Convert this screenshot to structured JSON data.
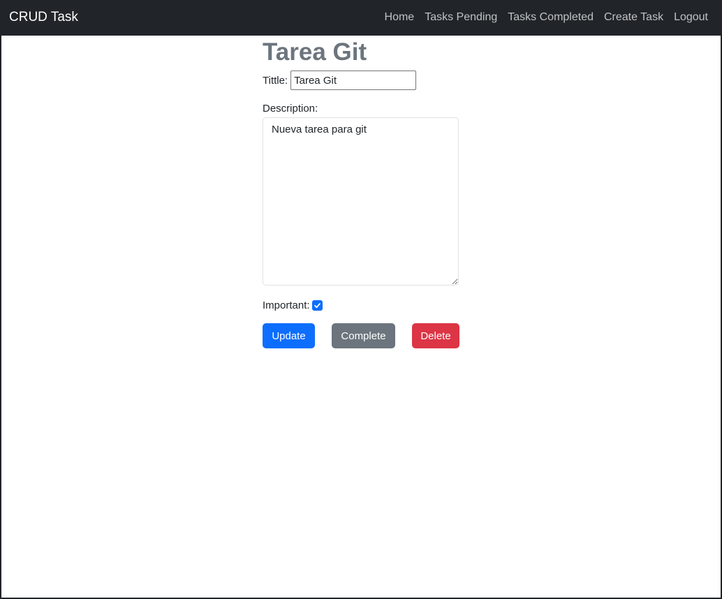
{
  "navbar": {
    "brand": "CRUD Task",
    "links": [
      "Home",
      "Tasks Pending",
      "Tasks Completed",
      "Create Task",
      "Logout"
    ]
  },
  "task": {
    "heading": "Tarea Git",
    "title_label": "Tittle:",
    "title_value": "Tarea Git",
    "description_label": "Description:",
    "description_value": "Nueva tarea para git",
    "important_label": "Important:",
    "important_checked": true
  },
  "buttons": {
    "update": "Update",
    "complete": "Complete",
    "delete": "Delete"
  },
  "colors": {
    "navbar_bg": "#212529",
    "primary": "#0d6efd",
    "secondary": "#6c757d",
    "danger": "#dc3545"
  }
}
